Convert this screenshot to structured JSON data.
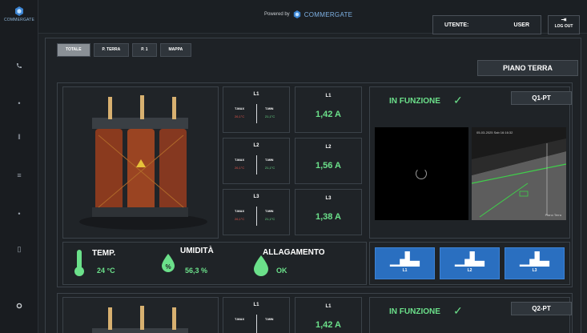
{
  "brand": {
    "logo_text": "COMMERGATE",
    "powered_by": "Powered by",
    "name": "COMMERGATE",
    "accent": "#2a6fc0",
    "ok_color": "#6be08a"
  },
  "user": {
    "label": "UTENTE:",
    "name": "USER"
  },
  "logout_label": "LOG OUT",
  "tabs": [
    {
      "label": "TOTALE",
      "active": true
    },
    {
      "label": "P. TERRA",
      "active": false
    },
    {
      "label": "P. 1",
      "active": false
    },
    {
      "label": "MAPPA",
      "active": false
    }
  ],
  "floor_label": "PIANO TERRA",
  "sidebar_icons": [
    "phone-icon",
    "dot-icon",
    "dot-icon",
    "bars-icon",
    "dot-icon",
    "door-icon",
    "circle-icon"
  ],
  "units": [
    {
      "id": "Q1-PT",
      "status": "IN FUNZIONE",
      "phases": [
        {
          "label": "L1",
          "tmax_label": "T.MAX",
          "tmax": "26,1°C",
          "tmin_label": "T.MIN",
          "tmin": "21,1°C",
          "current": "1,42 A"
        },
        {
          "label": "L2",
          "tmax_label": "T.MAX",
          "tmax": "26,1°C",
          "tmin_label": "T.MIN",
          "tmin": "21,1°C",
          "current": "1,56 A"
        },
        {
          "label": "L3",
          "tmax_label": "T.MAX",
          "tmax": "26,1°C",
          "tmin_label": "T.MIN",
          "tmin": "21,1°C",
          "current": "1,38 A"
        }
      ],
      "camera_timestamp": "05-03-2025 Sab 16:16:32",
      "camera_name": "Piano Terra",
      "env": {
        "temp_label": "TEMP.",
        "temp_value": "24 °C",
        "humidity_label": "UMIDITÀ",
        "humidity_value": "56,3 %",
        "flood_label": "ALLAGAMENTO",
        "flood_value": "OK"
      },
      "chart_buttons": [
        "L1",
        "L2",
        "L3"
      ]
    },
    {
      "id": "Q2-PT",
      "status": "IN FUNZIONE",
      "phases": [
        {
          "label": "L1",
          "tmax_label": "T.MAX",
          "tmin_label": "T.MIN",
          "current": "1,42 A"
        }
      ]
    }
  ]
}
